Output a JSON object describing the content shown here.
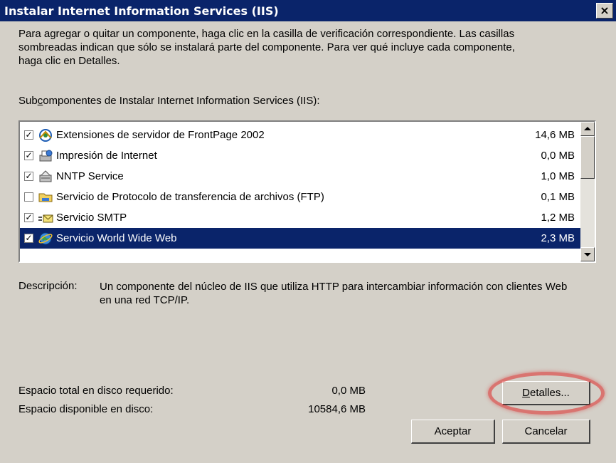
{
  "window": {
    "title": "Instalar Internet Information Services (IIS)",
    "close_label": "×"
  },
  "instructions": "Para agregar o quitar un componente, haga clic en la casilla de verificación correspondiente. Las casillas\nsombreadas indican que sólo se instalará parte del componente. Para ver qué incluye cada componente,\nhaga clic en Detalles.",
  "subcomponents_label": {
    "before": "Sub",
    "accel": "c",
    "after": "omponentes de Instalar Internet Information Services (IIS):"
  },
  "components": [
    {
      "name": "Extensiones de servidor de FrontPage 2002",
      "size": "14,6 MB",
      "checked": true,
      "selected": false,
      "icon": "frontpage-extensions-icon"
    },
    {
      "name": "Impresión de Internet",
      "size": "0,0 MB",
      "checked": true,
      "selected": false,
      "icon": "internet-printing-icon"
    },
    {
      "name": "NNTP Service",
      "size": "1,0 MB",
      "checked": true,
      "selected": false,
      "icon": "nntp-service-icon"
    },
    {
      "name": "Servicio de Protocolo de transferencia de archivos (FTP)",
      "size": "0,1 MB",
      "checked": false,
      "selected": false,
      "icon": "ftp-service-icon"
    },
    {
      "name": "Servicio SMTP",
      "size": "1,2 MB",
      "checked": true,
      "selected": false,
      "icon": "smtp-service-icon"
    },
    {
      "name": "Servicio World Wide Web",
      "size": "2,3 MB",
      "checked": true,
      "selected": true,
      "icon": "world-wide-web-icon"
    }
  ],
  "description": {
    "label": "Descripción:",
    "text": "Un componente del núcleo de IIS que utiliza HTTP para intercambiar información con clientes Web en una red TCP/IP."
  },
  "disk": {
    "required_label": "Espacio total en disco requerido:",
    "required_value": "0,0 MB",
    "available_label": "Espacio disponible en disco:",
    "available_value": "10584,6 MB"
  },
  "buttons": {
    "details_accel": "D",
    "details_rest": "etalles...",
    "accept": "Aceptar",
    "cancel": "Cancelar"
  },
  "colors": {
    "title_bar": "#0a246a",
    "selection": "#0a246a",
    "dialog_bg": "#d4d0c8",
    "highlight_ring": "#dc2828"
  }
}
